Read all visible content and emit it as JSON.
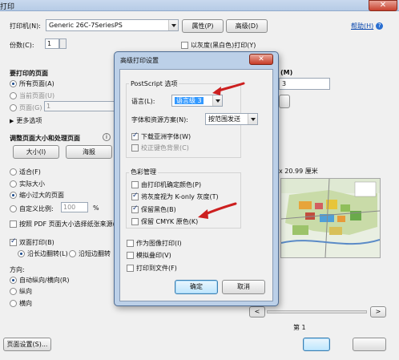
{
  "window": {
    "title": "打印",
    "close": "✕"
  },
  "printer": {
    "label": "打印机(N):",
    "value": "Generic 26C-7SeriesPS",
    "properties_button": "属性(P)",
    "advanced_button": "高级(D)",
    "help_link": "帮助(H)",
    "help_icon": "?"
  },
  "copies": {
    "label": "份数(C):",
    "value": "1"
  },
  "grayscale": {
    "label": "以灰度(黑白色)打印(Y)"
  },
  "pages": {
    "heading": "要打印的页面",
    "all": "所有页面(A)",
    "current": "当前页面(U)",
    "range_label": "页面(G)",
    "range_value": "1",
    "more": "更多选项"
  },
  "right_panel": {
    "heading_fragment": "(M)",
    "combo_fragment": "3",
    "size_text": "x 20.99 厘米",
    "page_label": "第 1",
    "prev": "<",
    "next": ">"
  },
  "sizing": {
    "heading": "调整页面大小和处理页面",
    "size_button": "大小(I)",
    "poster_button": "海报",
    "fit": "适合(F)",
    "actual": "实际大小",
    "shrink": "缩小过大的页面",
    "custom": "自定义比例:",
    "custom_value": "100",
    "custom_unit": "%",
    "pdf_source": "按照 PDF 页面大小选择纸张来源(Z)",
    "duplex": "双面打印(B)",
    "long_edge": "沿长边翻转(L)",
    "short_edge": "沿短边翻转"
  },
  "orientation": {
    "heading": "方向:",
    "auto": "自动纵向/横向(R)",
    "portrait": "纵向",
    "landscape": "横向"
  },
  "page_setup_button": "页面设置(S)...",
  "modal": {
    "title": "高级打印设置",
    "postscript_group": "PostScript 选项",
    "language_label": "语言(L):",
    "language_value": "语言级 3",
    "font_label": "字体和资源方案(N):",
    "font_value": "按范围发送",
    "download_asian": "下载亚洲字体(W)",
    "fix_bg": "校正键色背景(C)",
    "color_group": "色彩管理",
    "printer_color": "由打印机确定颜色(P)",
    "gray_as_k": "将灰度视为 K-only 灰度(T)",
    "keep_black": "保留黑色(B)",
    "keep_cmyk": "保留 CMYK 原色(K)",
    "as_image": "作为图像打印(I)",
    "simulate_overprint": "模拟叠印(V)",
    "print_to_file": "打印到文件(F)",
    "ok": "确定",
    "cancel": "取消"
  },
  "colors": {
    "accent": "#3c7fb1",
    "arrow": "#cc1f1f",
    "selection": "#3399ff"
  }
}
